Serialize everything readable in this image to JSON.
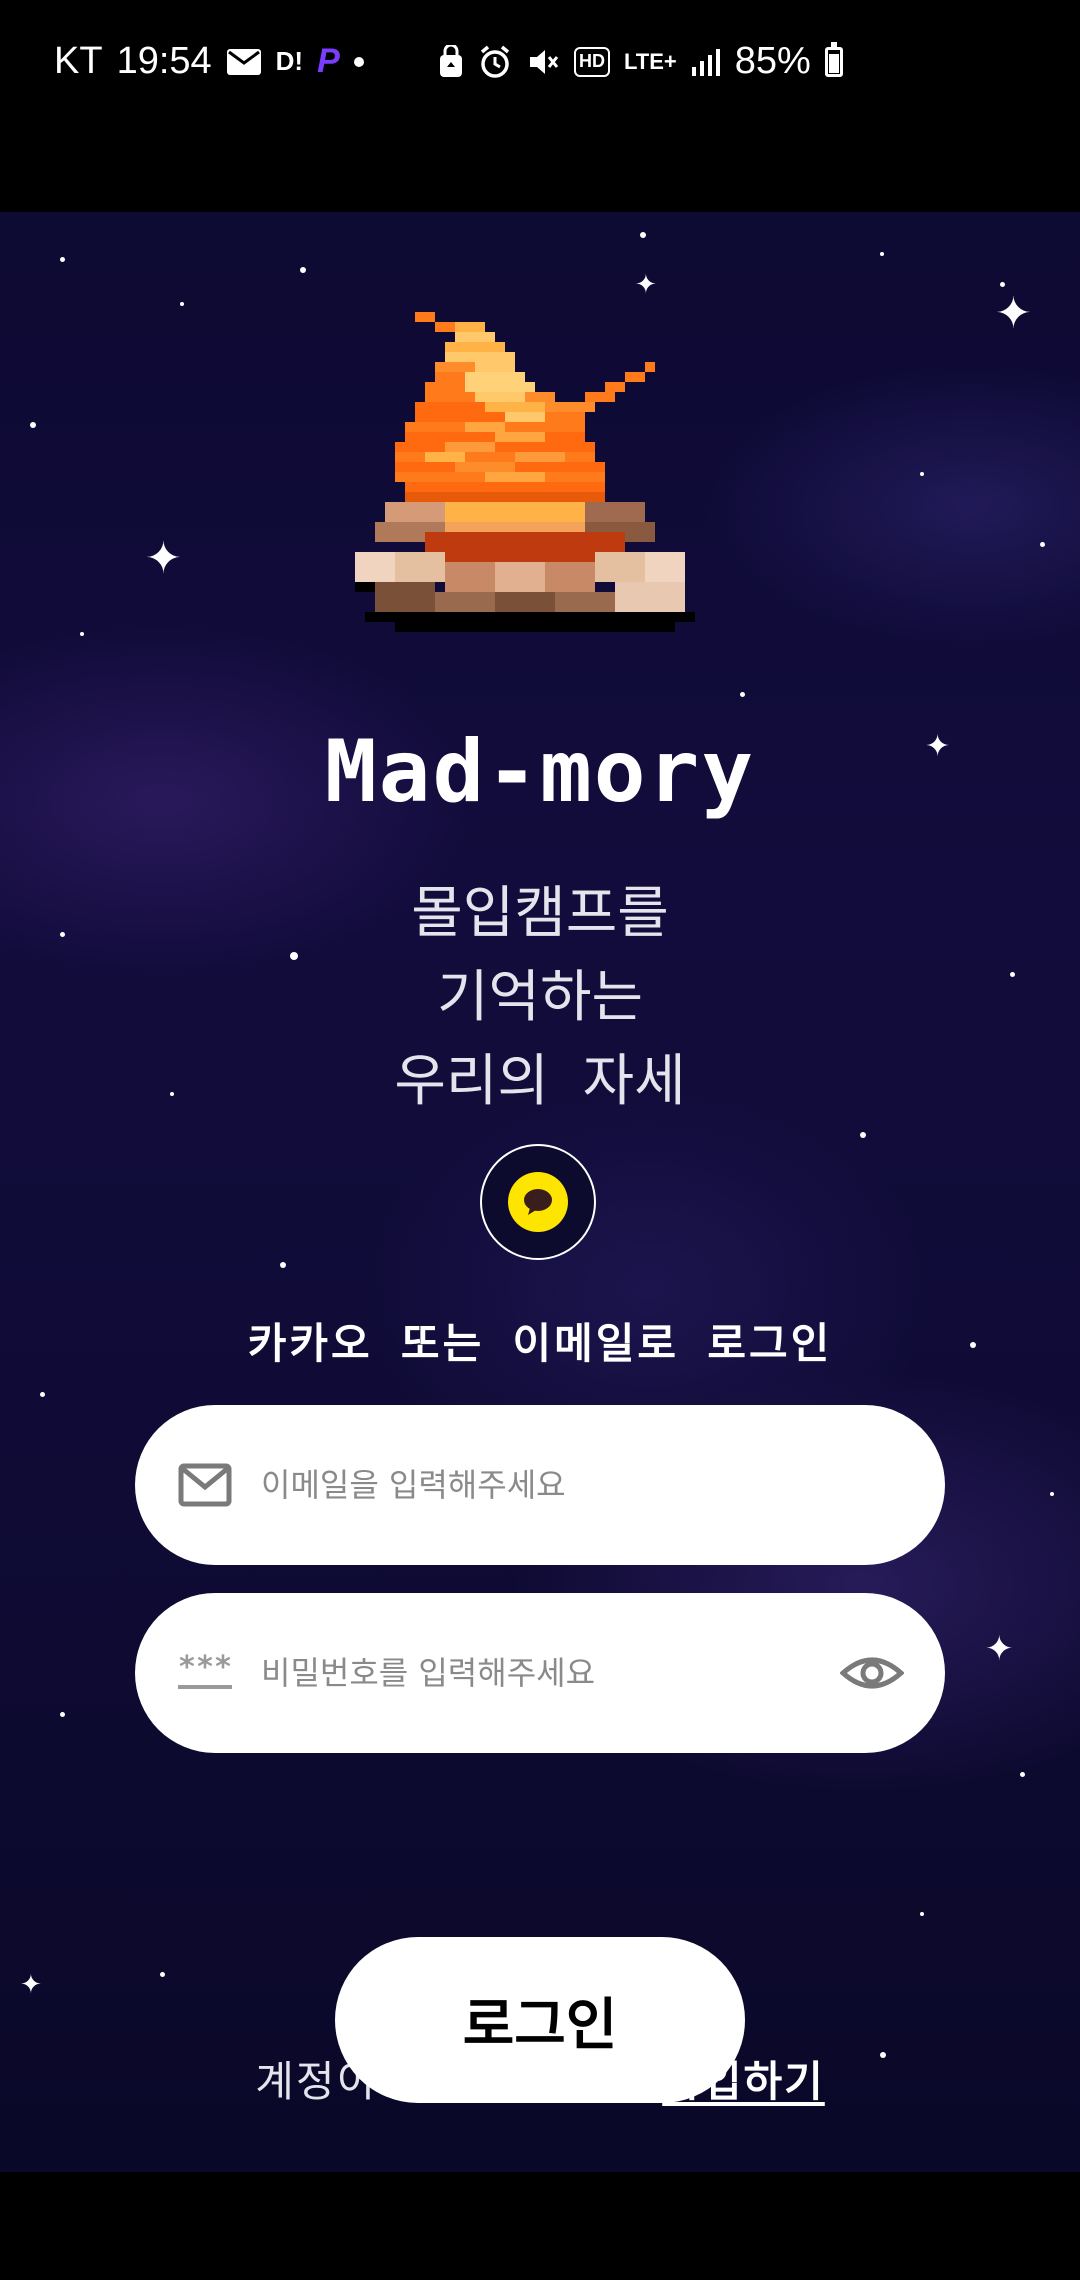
{
  "status_bar": {
    "carrier": "KT",
    "time": "19:54",
    "d_label": "D!",
    "p_label": "P",
    "network_hd": "HD",
    "network_lte": "LTE+",
    "battery_percent": "85%"
  },
  "app": {
    "title": "Mad-mory",
    "tagline_lines": [
      "몰입캠프를",
      "기억하는",
      "우리의 자세"
    ]
  },
  "login": {
    "hint": "카카오 또는 이메일로 로그인",
    "email_placeholder": "이메일을 입력해주세요",
    "password_placeholder": "비밀번호를 입력해주세요",
    "password_icon_text": "***",
    "signup_prompt": "계정이 없으신가요?",
    "signup_link": "가입하기",
    "login_button": "로그인"
  },
  "colors": {
    "kakao_yellow": "#fee500",
    "background": "#0f0b35"
  },
  "icons": {
    "kakao": "kakao-icon",
    "email": "mail-icon",
    "password": "password-icon",
    "visibility": "eye-icon"
  }
}
